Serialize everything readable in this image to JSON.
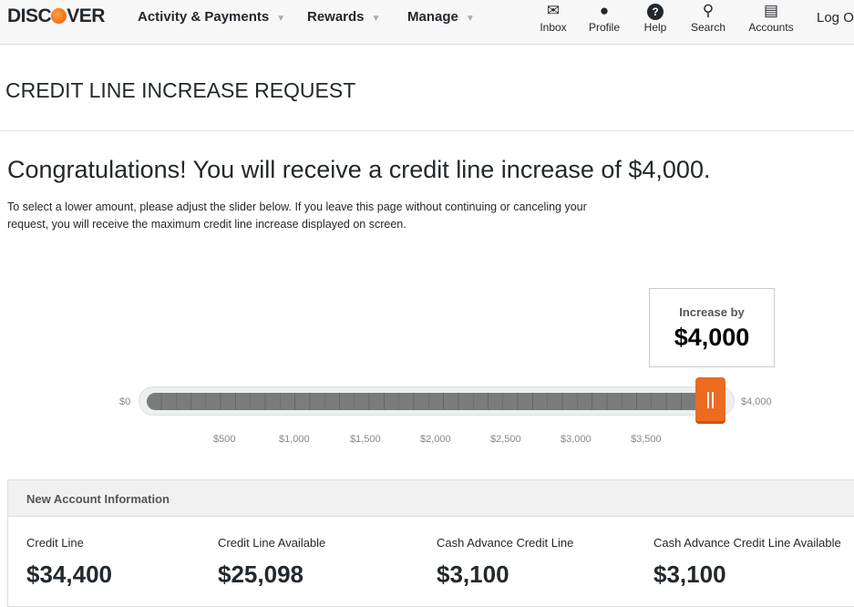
{
  "header": {
    "logo": "DISCOVER",
    "nav": [
      {
        "label": "Activity & Payments"
      },
      {
        "label": "Rewards"
      },
      {
        "label": "Manage"
      }
    ],
    "icons": [
      {
        "label": "Inbox",
        "icon": "envelope-icon"
      },
      {
        "label": "Profile",
        "icon": "person-icon"
      },
      {
        "label": "Help",
        "icon": "question-icon"
      },
      {
        "label": "Search",
        "icon": "search-icon"
      },
      {
        "label": "Accounts",
        "icon": "cards-icon"
      }
    ],
    "logout": "Log Out"
  },
  "page": {
    "title": "CREDIT LINE INCREASE REQUEST",
    "heading": "Congratulations! You will receive a credit line increase of $4,000.",
    "description": "To select a lower amount, please adjust the slider below. If you leave this page without continuing or canceling your request, you will receive the maximum credit line increase displayed on screen."
  },
  "slider": {
    "min_label": "$0",
    "max_label": "$4,000",
    "value": 4000,
    "tooltip_label": "Increase by",
    "tooltip_value": "$4,000",
    "ticks": [
      "$500",
      "$1,000",
      "$1,500",
      "$2,000",
      "$2,500",
      "$3,000",
      "$3,500"
    ],
    "accent": "#ed6a21"
  },
  "panel": {
    "title": "New Account Information",
    "items": [
      {
        "label": "Credit Line",
        "value": "$34,400"
      },
      {
        "label": "Credit Line Available",
        "value": "$25,098"
      },
      {
        "label": "Cash Advance Credit Line",
        "value": "$3,100"
      },
      {
        "label": "Cash Advance Credit Line Available",
        "value": "$3,100"
      }
    ]
  }
}
